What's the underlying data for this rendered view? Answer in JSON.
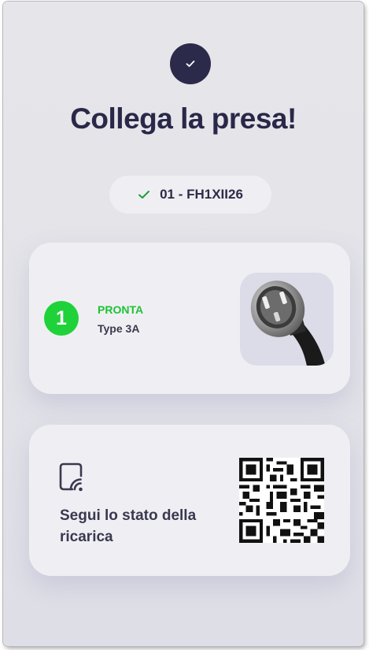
{
  "header": {
    "check_icon": "check-icon",
    "title": "Collega la presa!"
  },
  "station": {
    "check_icon": "check-icon",
    "code": "01 - FH1XII26",
    "accent": "#1f9e3a"
  },
  "connector": {
    "number": "1",
    "status": "PRONTA",
    "type": "Type 3A",
    "status_color": "#1fd23a",
    "image": "ev-plug-image"
  },
  "tracking": {
    "icon": "cast-icon",
    "label": "Segui lo stato della ricarica",
    "qr": "qr-code"
  },
  "colors": {
    "primary": "#2a2848",
    "card_bg": "#efeff3",
    "background": "#e4e4ea"
  }
}
